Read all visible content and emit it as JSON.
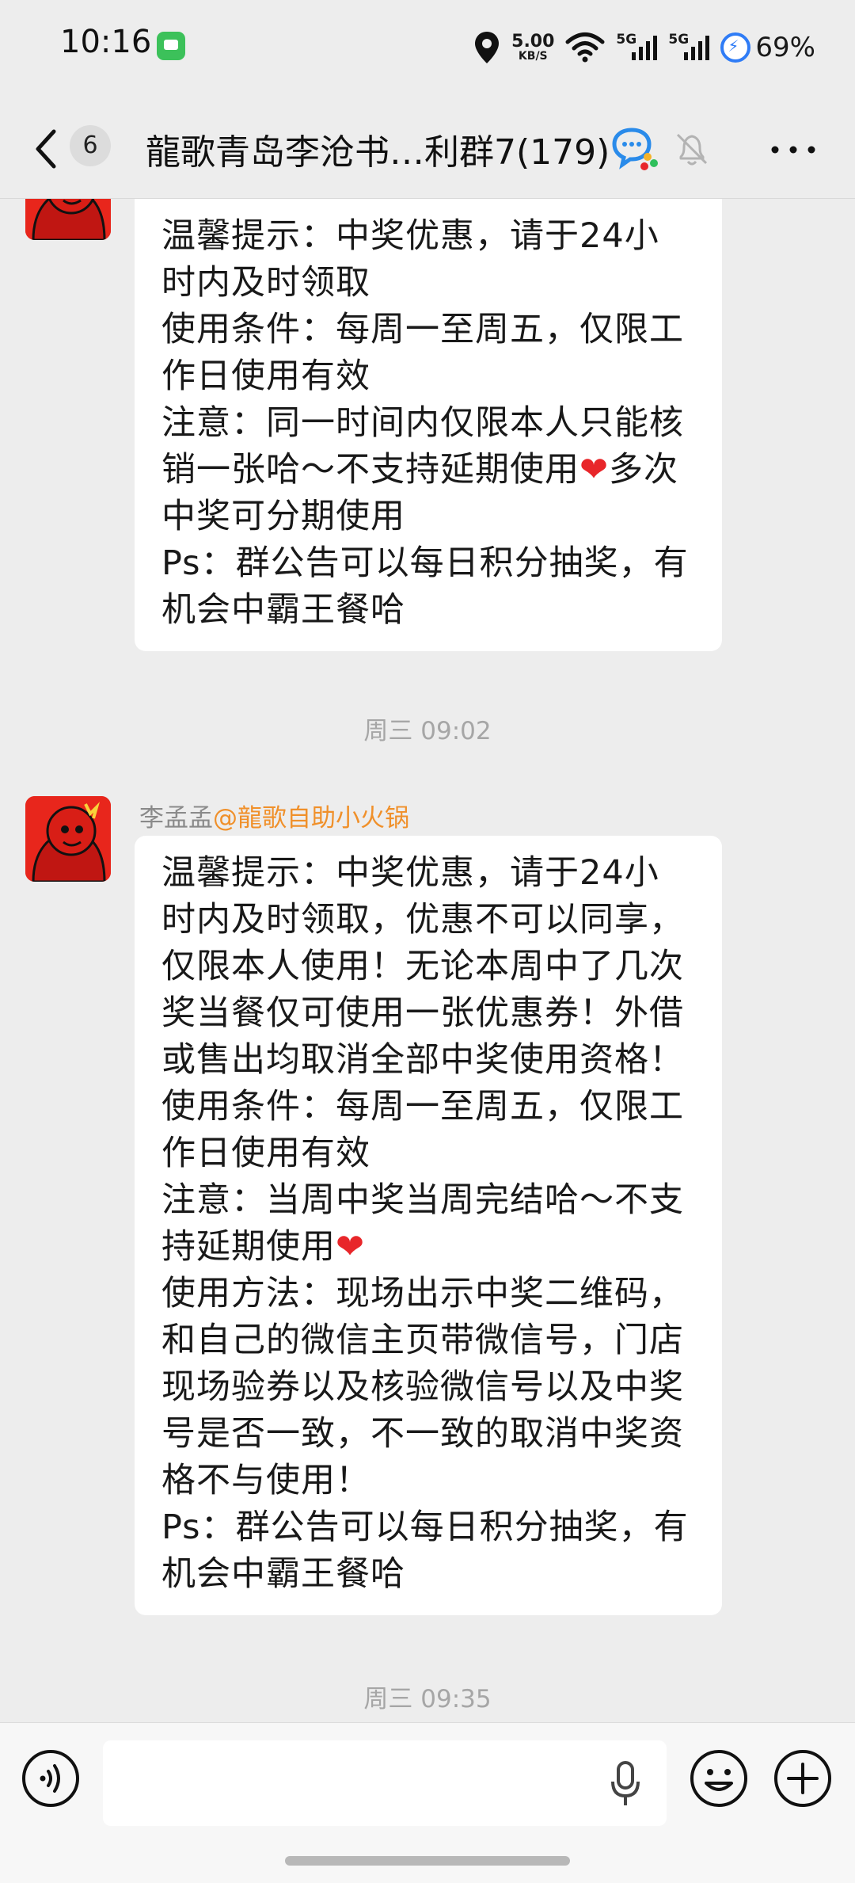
{
  "status_bar": {
    "time": "10:16",
    "net_speed_value": "5.00",
    "net_speed_unit": "KB/S",
    "sim1_label": "5G",
    "sim2_label": "5G",
    "battery": "69%"
  },
  "nav": {
    "unread_count": "6",
    "title": "龍歌青岛李沧书…利群7(179)"
  },
  "messages": [
    {
      "lines": [
        "温馨提示：中奖优惠，请于24小",
        "时内及时领取",
        "使用条件：每周一至周五，仅限工",
        "作日使用有效",
        "注意：同一时间内仅限本人只能核",
        "销一张哈～不支持延期使用",
        "多次",
        "中奖可分期使用",
        "Ps：群公告可以每日积分抽奖，有",
        "机会中霸王餐哈"
      ]
    },
    {
      "timestamp": "周三 09:02",
      "sender": "李孟孟",
      "mention": "@龍歌自助小火锅",
      "lines": [
        "温馨提示：中奖优惠，请于24小",
        "时内及时领取，优惠不可以同享，",
        "仅限本人使用！无论本周中了几次",
        "奖当餐仅可使用一张优惠券！外借",
        "或售出均取消全部中奖使用资格！",
        "使用条件：每周一至周五，仅限工",
        "作日使用有效",
        "注意：当周中奖当周完结哈～不支",
        "持延期使用",
        "使用方法：现场出示中奖二维码，",
        "和自己的微信主页带微信号，门店",
        "现场验券以及核验微信号以及中奖",
        "号是否一致，不一致的取消中奖资",
        "格不与使用！",
        "Ps：群公告可以每日积分抽奖，有",
        "机会中霸王餐哈"
      ]
    },
    {
      "timestamp": "周三 09:35"
    }
  ],
  "icons": {
    "heart": "❤"
  },
  "colors": {
    "background": "#ededed",
    "bubble": "#ffffff",
    "mention": "#f0902a",
    "heart": "#e8262a",
    "avatar_bg": "#e8261c"
  }
}
